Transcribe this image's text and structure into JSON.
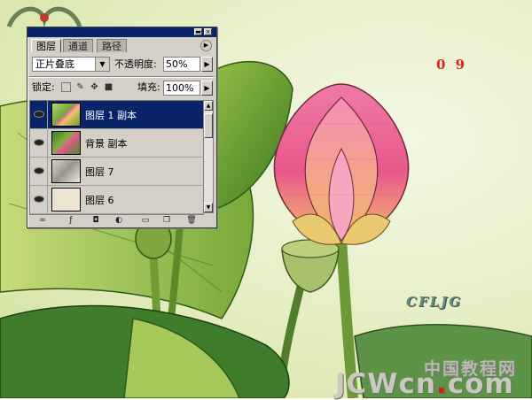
{
  "artwork": {
    "step_number": "0 9",
    "watermark_cn": "中国教程网",
    "watermark_en_main": "JCWcn",
    "watermark_en_dot": ".",
    "watermark_en_tail": "com",
    "logo_text": "CFLJG"
  },
  "layers_panel": {
    "tabs": [
      {
        "label": "图层",
        "active": true
      },
      {
        "label": "通道",
        "active": false
      },
      {
        "label": "路径",
        "active": false
      }
    ],
    "blend_mode": "正片叠底",
    "opacity_label": "不透明度:",
    "opacity_value": "50%",
    "lock_label": "锁定:",
    "fill_label": "填充:",
    "fill_value": "100%",
    "layers": [
      {
        "name": "图层 1 副本",
        "visible": true,
        "selected": true,
        "thumb": "lotus-photo"
      },
      {
        "name": "背景 副本",
        "visible": true,
        "selected": false,
        "thumb": "lotus-green"
      },
      {
        "name": "图层 7",
        "visible": true,
        "selected": false,
        "thumb": "lotus-grey"
      },
      {
        "name": "图层 6",
        "visible": true,
        "selected": false,
        "thumb": "solid-beige"
      }
    ],
    "bottom_icons": [
      "link-icon",
      "layer-style-icon",
      "mask-icon",
      "adjustment-layer-icon",
      "new-group-icon",
      "new-layer-icon",
      "trash-icon"
    ]
  },
  "colors": {
    "titlebar": "#0a246a",
    "selection": "#0a246a",
    "step_number": "#e02020",
    "lotus_pink": "#e8588a",
    "lotus_base": "#f4c26a",
    "thumb_beige": "#efe3d2"
  }
}
